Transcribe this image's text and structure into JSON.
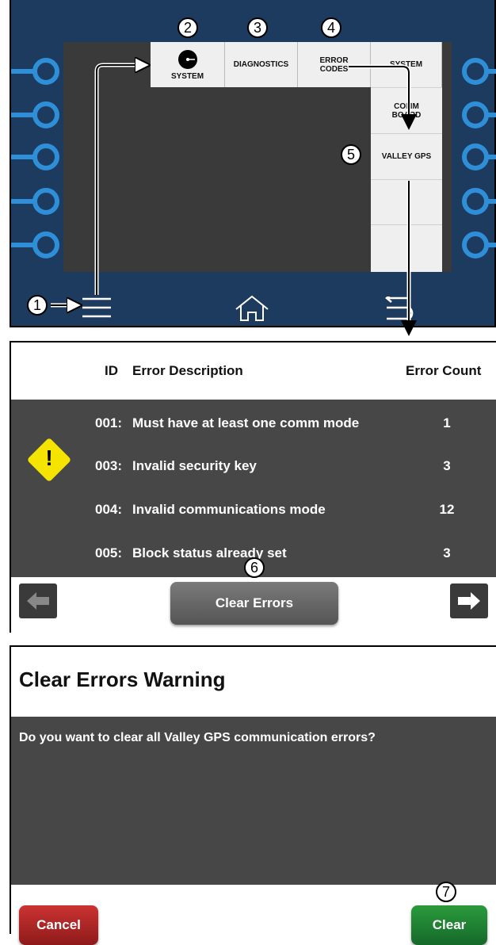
{
  "panel1": {
    "menu_tabs": [
      {
        "label": "SYSTEM"
      },
      {
        "label": "DIAGNOSTICS"
      },
      {
        "label": "ERROR CODES"
      },
      {
        "label": "SYSTEM"
      }
    ],
    "submenu": [
      {
        "label": "COMM BOARD"
      },
      {
        "label": "VALLEY GPS"
      }
    ],
    "callouts": [
      "1",
      "2",
      "3",
      "4",
      "5",
      "6",
      "7"
    ],
    "bottom_icons": [
      "menu-icon",
      "home-icon",
      "back-icon"
    ]
  },
  "panel2": {
    "headers": {
      "id": "ID",
      "description": "Error Description",
      "count": "Error Count"
    },
    "rows": [
      {
        "id": "001:",
        "description": "Must have at least one comm mode",
        "count": "1"
      },
      {
        "id": "003:",
        "description": "Invalid security key",
        "count": "3"
      },
      {
        "id": "004:",
        "description": "Invalid communications mode",
        "count": "12"
      },
      {
        "id": "005:",
        "description": "Block status already set",
        "count": "3"
      }
    ],
    "warning_symbol": "!",
    "clear_errors_label": "Clear Errors"
  },
  "panel3": {
    "title": "Clear Errors Warning",
    "message": "Do you want to clear all Valley GPS communication errors?",
    "cancel_label": "Cancel",
    "clear_label": "Clear"
  },
  "colors": {
    "screen_frame": "#1d3b5e",
    "connector": "#2e8fd8",
    "cancel": "#b22222",
    "clear": "#1f8a34",
    "warning": "#f5e400"
  }
}
